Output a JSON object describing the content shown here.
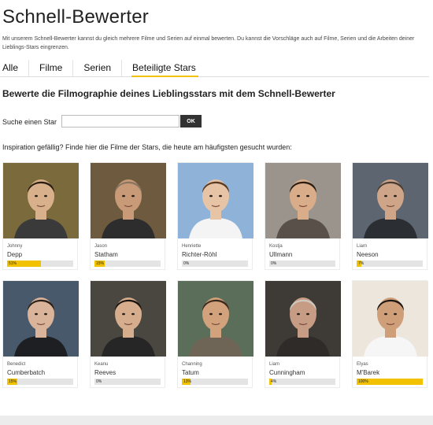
{
  "header": {
    "title": "Schnell-Bewerter",
    "intro": "Mit unserem Schnell-Bewerter kannst du gleich mehrere Filme und Serien auf einmal bewerten. Du kannst die Vorschläge auch auf Filme, Serien und die Arbeiten deiner Lieblings-Stars eingrenzen."
  },
  "tabs": [
    {
      "label": "Alle"
    },
    {
      "label": "Filme"
    },
    {
      "label": "Serien"
    },
    {
      "label": "Beteiligte Stars",
      "active": true
    }
  ],
  "main": {
    "heading": "Bewerte die Filmographie deines Lieblingsstars mit dem Schnell-Bewerter",
    "search": {
      "label": "Suche einen Star",
      "value": "",
      "placeholder": "",
      "button_label": "OK"
    },
    "inspiration": "Inspiration gefällig? Finde hier die Filme der Stars, die heute am häufigsten gesucht wurden:"
  },
  "colors": {
    "accent": "#f2c200",
    "bar_track": "#e4e4e4",
    "button": "#333333"
  },
  "stars": [
    {
      "first": "Johnny",
      "last": "Depp",
      "progress_text": "51%",
      "progress": 0.51,
      "icon": "portrait-photo"
    },
    {
      "first": "Jason",
      "last": "Statham",
      "progress_text": "15%",
      "progress": 0.15,
      "icon": "portrait-photo"
    },
    {
      "first": "Henriette",
      "last": "Richter-Röhl",
      "progress_text": "0%",
      "progress": 0.0,
      "icon": "portrait-photo"
    },
    {
      "first": "Kostja",
      "last": "Ullmann",
      "progress_text": "0%",
      "progress": 0.0,
      "icon": "portrait-photo"
    },
    {
      "first": "Liam",
      "last": "Neeson",
      "progress_text": "7%",
      "progress": 0.07,
      "icon": "portrait-photo"
    },
    {
      "first": "Benedict",
      "last": "Cumberbatch",
      "progress_text": "15%",
      "progress": 0.15,
      "icon": "portrait-photo"
    },
    {
      "first": "Keanu",
      "last": "Reeves",
      "progress_text": "0%",
      "progress": 0.0,
      "icon": "portrait-photo"
    },
    {
      "first": "Channing",
      "last": "Tatum",
      "progress_text": "13%",
      "progress": 0.13,
      "icon": "portrait-photo"
    },
    {
      "first": "Liam",
      "last": "Cunningham",
      "progress_text": "4%",
      "progress": 0.04,
      "icon": "portrait-photo"
    },
    {
      "first": "Elyas",
      "last": "M'Barek",
      "progress_text": "100%",
      "progress": 1.0,
      "icon": "portrait-photo"
    }
  ]
}
